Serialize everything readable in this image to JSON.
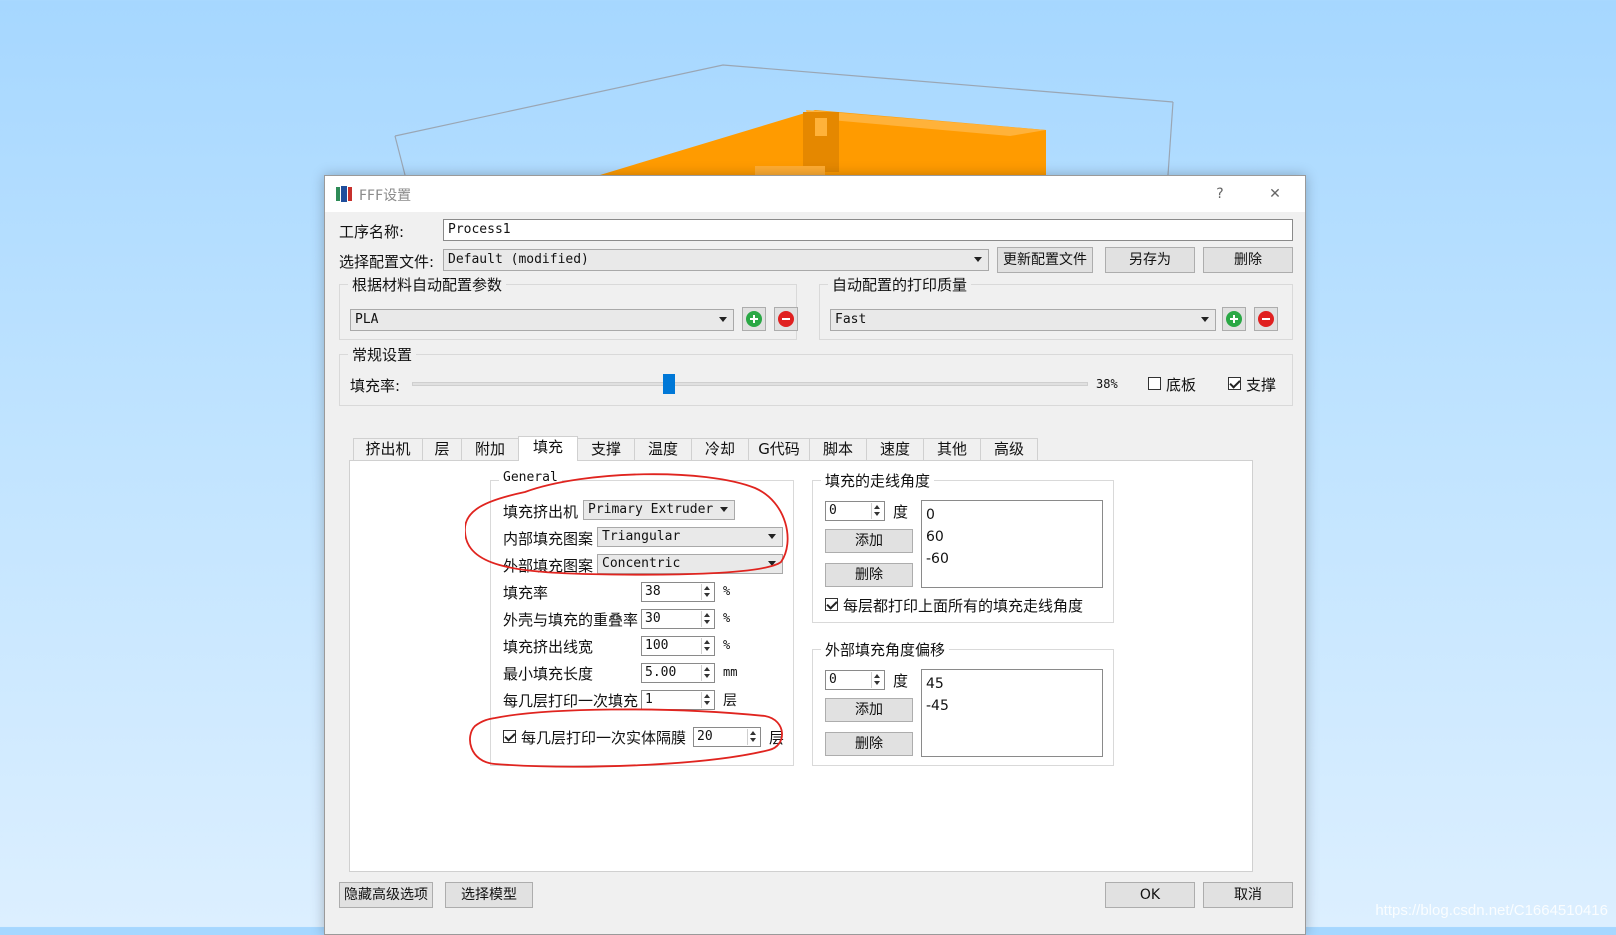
{
  "dialog": {
    "title": "FFF设置",
    "help": "?",
    "close": "✕"
  },
  "process": {
    "name_label": "工序名称:",
    "name_value": "Process1",
    "profile_label": "选择配置文件:",
    "profile_value": "Default (modified)",
    "update_btn": "更新配置文件",
    "saveas_btn": "另存为",
    "delete_btn": "删除"
  },
  "material_group": {
    "title": "根据材料自动配置参数",
    "value": "PLA"
  },
  "quality_group": {
    "title": "自动配置的打印质量",
    "value": "Fast"
  },
  "general_group": {
    "title": "常规设置",
    "infill_label": "填充率:",
    "infill_value": "38%",
    "infill_level": 0.38,
    "raft_label": "底板",
    "raft_checked": false,
    "support_label": "支撑",
    "support_checked": true
  },
  "tabs": [
    "挤出机",
    "层",
    "附加",
    "填充",
    "支撑",
    "温度",
    "冷却",
    "G代码",
    "脚本",
    "速度",
    "其他",
    "高级"
  ],
  "active_tab_index": 3,
  "infill": {
    "group_title": "General",
    "extruder_label": "填充挤出机",
    "extruder_value": "Primary Extruder",
    "interior_label": "内部填充图案",
    "interior_value": "Triangular",
    "exterior_label": "外部填充图案",
    "exterior_value": "Concentric",
    "rows": [
      {
        "label": "填充率",
        "value": "38",
        "unit": "%"
      },
      {
        "label": "外壳与填充的重叠率",
        "value": "30",
        "unit": "%"
      },
      {
        "label": "填充挤出线宽",
        "value": "100",
        "unit": "%"
      },
      {
        "label": "最小填充长度",
        "value": "5.00",
        "unit": "mm"
      },
      {
        "label": "每几层打印一次填充",
        "value": "1",
        "unit": "层"
      }
    ],
    "solid_label": "每几层打印一次实体隔膜",
    "solid_value": "20",
    "solid_unit": "层",
    "solid_checked": true
  },
  "angles": {
    "title": "填充的走线角度",
    "spin_value": "0",
    "unit": "度",
    "add": "添加",
    "delete": "删除",
    "list": [
      "0",
      "60",
      "-60"
    ],
    "check_label": "每层都打印上面所有的填充走线角度",
    "checked": true
  },
  "offset": {
    "title": "外部填充角度偏移",
    "spin_value": "0",
    "unit": "度",
    "add": "添加",
    "delete": "删除",
    "list": [
      "45",
      "-45"
    ]
  },
  "footer": {
    "hide_btn": "隐藏高级选项",
    "select_btn": "选择模型",
    "ok_btn": "OK",
    "cancel_btn": "取消"
  },
  "watermark": "https://blog.csdn.net/C1664510416",
  "colors": {
    "model": "#ff9900",
    "accent": "#0078d7",
    "annotation": "#e0241f"
  }
}
